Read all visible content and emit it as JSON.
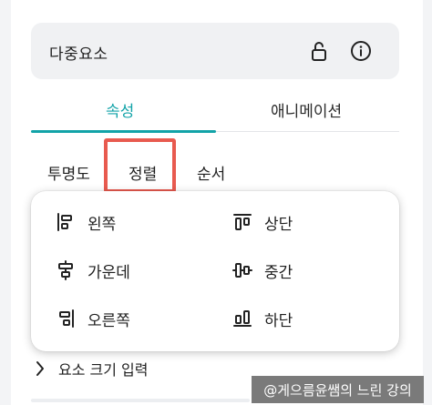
{
  "header": {
    "title": "다중요소",
    "lock_icon": "lock-open-icon",
    "info_icon": "info-icon"
  },
  "tabs": [
    {
      "label": "속성",
      "active": true
    },
    {
      "label": "애니메이션",
      "active": false
    }
  ],
  "subtabs": [
    {
      "label": "투명도"
    },
    {
      "label": "정렬",
      "highlighted": true
    },
    {
      "label": "순서"
    }
  ],
  "align_menu": {
    "left": {
      "label": "왼쪽",
      "icon": "align-left-icon"
    },
    "center": {
      "label": "가운데",
      "icon": "align-center-icon"
    },
    "right": {
      "label": "오른쪽",
      "icon": "align-right-icon"
    },
    "top": {
      "label": "상단",
      "icon": "align-top-icon"
    },
    "middle": {
      "label": "중간",
      "icon": "align-middle-icon"
    },
    "bottom": {
      "label": "하단",
      "icon": "align-bottom-icon"
    }
  },
  "size_section": {
    "label": "요소 크기 입력",
    "icon": "chevron-right-icon"
  },
  "watermark": {
    "text": "@게으름윤쌤의 느린 강의"
  },
  "colors": {
    "accent": "#12a3a8",
    "highlight": "#e85a4f"
  }
}
